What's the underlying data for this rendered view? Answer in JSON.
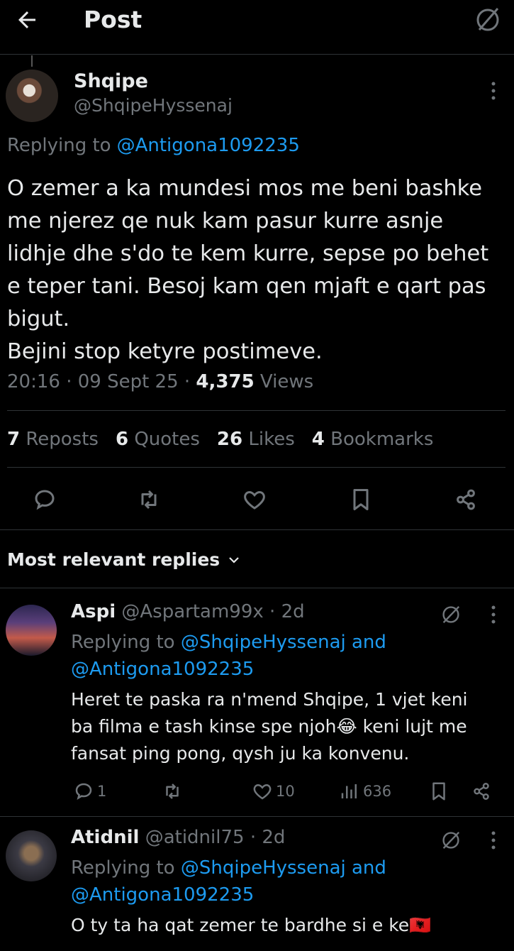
{
  "header": {
    "title": "Post"
  },
  "post": {
    "name": "Shqipe",
    "handle": "@ShqipeHyssenaj",
    "replying_prefix": "Replying to",
    "replying_to": "@Antigona1092235",
    "lines": [
      "O zemer a ka mundesi mos me beni bashke",
      "me njerez qe nuk kam pasur kurre asnje",
      "lidhje dhe s'do te kem kurre, sepse po behet",
      "e teper tani. Besoj kam qen mjaft e qart pas",
      "bigut.",
      "Bejini stop ketyre postimeve."
    ],
    "time": "20:16 · 09 Sept 25 · ",
    "views_count": "4,375",
    "views_label": " Views",
    "stats": {
      "reposts_count": "7",
      "reposts_label": "Reposts",
      "quotes_count": "6",
      "quotes_label": "Quotes",
      "likes_count": "26",
      "likes_label": "Likes",
      "bookmarks_count": "4",
      "bookmarks_label": "Bookmarks"
    }
  },
  "replies_header": "Most relevant replies",
  "replies": [
    {
      "name": "Aspi",
      "handle": "@Aspartam99x",
      "age": " · 2d",
      "replying_prefix": "Replying to",
      "replying_line1": "@ShqipeHyssenaj and",
      "replying_line2": "@Antigona1092235",
      "lines": [
        "Heret te paska ra n'mend Shqipe, 1 vjet keni",
        "ba filma e tash kinse spe njoh😂 keni lujt me",
        "fansat ping pong, qysh ju ka konvenu."
      ],
      "replies_count": "1",
      "likes_count": "10",
      "views_count": "636"
    },
    {
      "name": "Atidnil",
      "handle": "@atidnil75",
      "age": " · 2d",
      "replying_prefix": "Replying to",
      "replying_line1": "@ShqipeHyssenaj and",
      "replying_line2": "@Antigona1092235",
      "lines": [
        "O ty ta ha qat zemer te bardhe si e ke🇦🇱"
      ]
    }
  ],
  "colors": {
    "background": "#000000",
    "text": "#e7e9ea",
    "muted": "#71767b",
    "link": "#1d9bf0",
    "divider": "#2f3336"
  }
}
